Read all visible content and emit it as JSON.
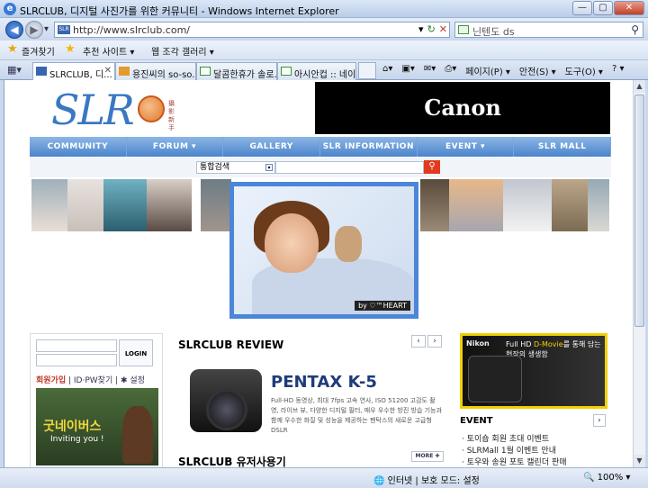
{
  "window": {
    "title": "SLRCLUB, 디지털 사진가를 위한 커뮤니티 - Windows Internet Explorer",
    "ie_icon": "e",
    "buttons": {
      "minimize": "—",
      "maximize": "▢",
      "close": "✕"
    }
  },
  "address_bar": {
    "back": "◀",
    "forward": "▶",
    "recent": "▾",
    "favicon": "SLR",
    "url": "http://www.slrclub.com/",
    "refresh": "↻",
    "stop": "✕",
    "controls_dropdown": "▾"
  },
  "search_bar": {
    "value": "닌텐도 ds",
    "go": "⚲"
  },
  "favorites_bar": {
    "favorites_label": "즐겨찾기",
    "suggested_sites": "추천 사이트 ▾",
    "web_slice": "웹 조각 갤러리 ▾"
  },
  "tabs": [
    {
      "label": "SLRCLUB, 디...",
      "active": true
    },
    {
      "label": "용진씨의 so-so...",
      "active": false
    },
    {
      "label": "달콤한휴가 솔로...",
      "active": false
    },
    {
      "label": "아시안컵 :: 네이...",
      "active": false
    }
  ],
  "tab_close": "✕",
  "command_bar": {
    "page": "페이지(P) ▾",
    "safety": "안전(S) ▾",
    "tools": "도구(O) ▾",
    "help": "? ▾"
  },
  "site": {
    "logo_text": "SLR",
    "logo_sub": "攝影新手",
    "ad_brand": "Canon",
    "nav": [
      "COMMUNITY",
      "FORUM ▾",
      "GALLERY",
      "SLR INFORMATION ▾",
      "EVENT ▾",
      "SLR MALL"
    ],
    "search": {
      "select_value": "통합검색",
      "dropdown": "▾",
      "button": "⚲"
    },
    "hero_credit": "by ♡™HEART",
    "login": {
      "button": "LOGIN",
      "join": "회원가입",
      "find": "ID·PW찾기",
      "settings": "✱ 설정"
    },
    "promo": {
      "title": "굿네이버스",
      "sub": "Inviting you !"
    },
    "review": {
      "heading": "SLRCLUB REVIEW",
      "prev": "‹",
      "next": "›",
      "product": "PENTAX K-5",
      "description": "Full-HD 동영상, 최대 7fps 고속 연사, ISO 51200 고감도 촬영, 라이브 뷰, 다양한 디지털 필터, 매우 우수한 방진 방습 기능과 함께 우수한 화질 및 성능을 제공하는 펜탁스의 새로운 고급형 DSLR",
      "user_heading": "SLRCLUB 유저사용기",
      "more": "MORE ✚"
    },
    "side_ad": {
      "brand": "Nikon",
      "line1": "Full HD",
      "line1_hl": "D-Movie",
      "line1_tail": "를 통해 담는",
      "line2": "현장의 생생함"
    },
    "event": {
      "heading": "EVENT",
      "more": "›",
      "items": [
        "· 토이숍 회원 초대 이벤트",
        "· SLRMall 1월 이벤트 안내",
        "· 토우와 송원 포토 캘린더 판매"
      ]
    }
  },
  "scrollbar": {
    "up": "▲",
    "down": "▼"
  },
  "status_bar": {
    "zone": "🌐 인터넷 | 보호 모드: 설정",
    "zoom": "🔍 100% ▾"
  }
}
